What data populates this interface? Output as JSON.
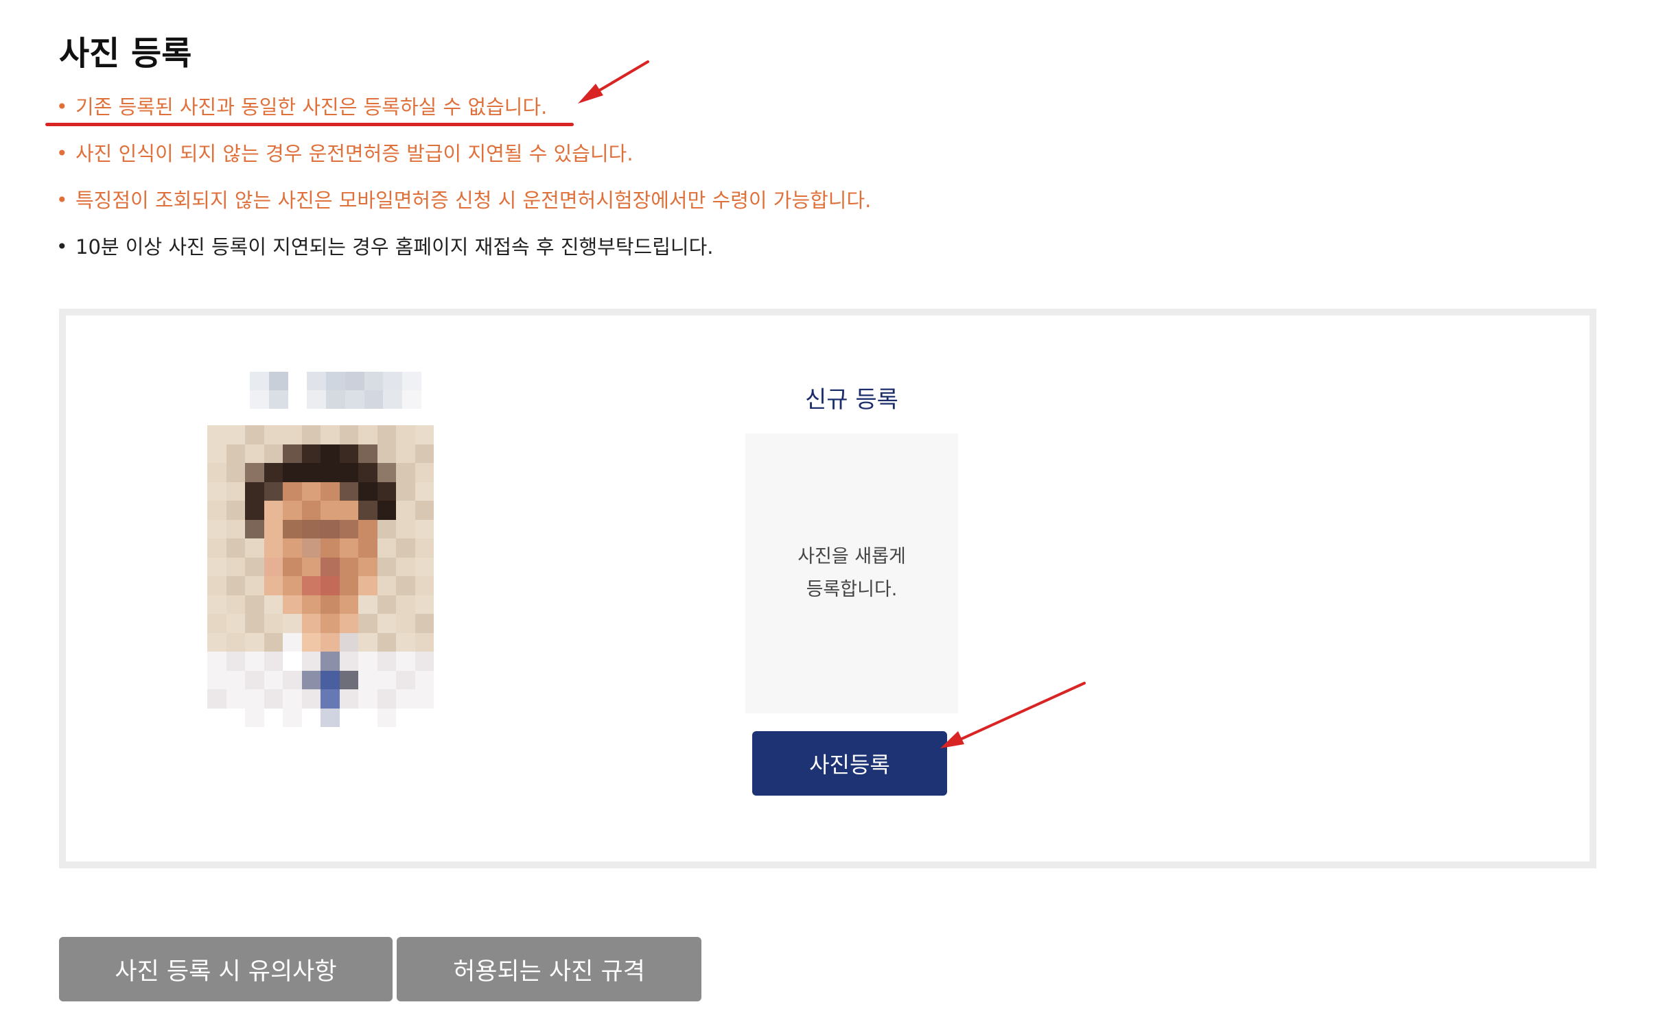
{
  "page": {
    "title": "사진 등록"
  },
  "notices": [
    {
      "bullet": "•",
      "text": "기존 등록된 사진과 동일한 사진은 등록하실 수 없습니다."
    },
    {
      "bullet": "•",
      "text": "사진 인식이 되지 않는 경우 운전면허증 발급이 지연될 수 있습니다."
    },
    {
      "bullet": "•",
      "text": "특징점이 조회되지 않는 사진은 모바일면허증 신청 시 운전면허시험장에서만 수령이 가능합니다."
    },
    {
      "bullet": "•",
      "text": "10분 이상 사진 등록이 지연되는 경우 홈페이지 재접속 후 진행부탁드립니다."
    }
  ],
  "new_registration": {
    "title": "신규 등록",
    "placeholder_text": "사진을 새롭게\n등록합니다.",
    "button_label": "사진등록"
  },
  "bottom_tabs": [
    {
      "label": "사진 등록 시 유의사항"
    },
    {
      "label": "허용되는 사진 규격"
    }
  ],
  "colors": {
    "warning_text": "#e0703a",
    "plain_text": "#222222",
    "primary_button": "#1d3373",
    "secondary_button": "#8a8a8a",
    "annotation_red": "#d92424",
    "box_border": "#ececec",
    "placeholder_bg": "#f7f7f7"
  }
}
